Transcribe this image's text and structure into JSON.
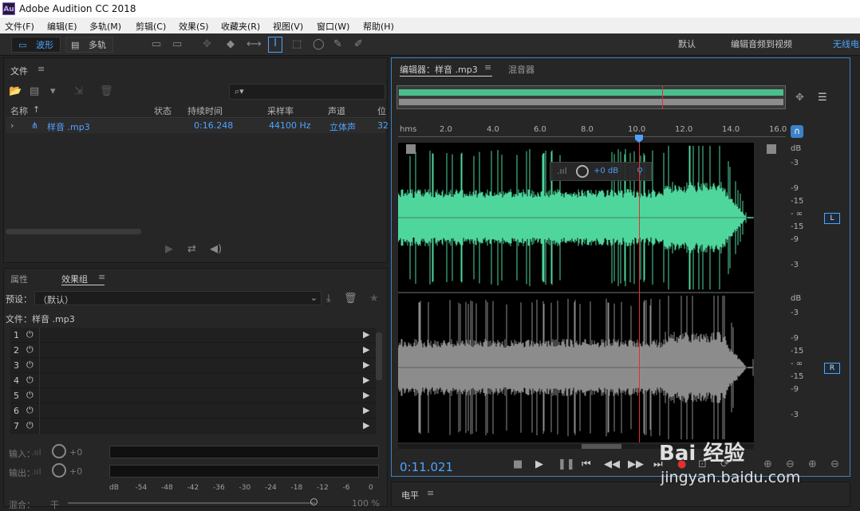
{
  "app": {
    "title": "Adobe Audition CC 2018",
    "icon_text": "Au"
  },
  "menubar": {
    "items": [
      "文件(F)",
      "编辑(E)",
      "多轨(M)",
      "剪辑(C)",
      "效果(S)",
      "收藏夹(R)",
      "视图(V)",
      "窗口(W)",
      "帮助(H)"
    ]
  },
  "toolbar": {
    "waveform_label": "波形",
    "multitrack_label": "多轨",
    "workspace_default": "默认",
    "workspace_edit_video": "编辑音频到视频",
    "workspace_wireless": "无线电"
  },
  "files_panel": {
    "title": "文件",
    "columns": [
      "名称",
      "状态",
      "持续时间",
      "采样率",
      "声道",
      "位"
    ],
    "rows": [
      {
        "name": "样音 .mp3",
        "status": "",
        "duration": "0:16.248",
        "sample_rate": "44100 Hz",
        "channels": "立体声",
        "bits": "32"
      }
    ]
  },
  "effects_panel": {
    "tab_properties": "属性",
    "tab_effects_rack": "效果组",
    "preset_label": "预设：",
    "preset_value": "（默认）",
    "file_label": "文件：样音 .mp3",
    "slots": [
      "1",
      "2",
      "3",
      "4",
      "5",
      "6",
      "7"
    ],
    "input_label": "输入：",
    "input_value": "+0",
    "output_label": "输出：",
    "output_value": "+0",
    "db_scale": [
      "dB",
      "-54",
      "-48",
      "-42",
      "-36",
      "-30",
      "-24",
      "-18",
      "-12",
      "-6",
      "0"
    ],
    "mix_label": "混合：",
    "mix_left": "干",
    "mix_value": "100 %"
  },
  "editor": {
    "tab_editor": "编辑器：样音 .mp3",
    "tab_mixer": "混音器",
    "time_unit": "hms",
    "ticks": [
      "2.0",
      "4.0",
      "6.0",
      "8.0",
      "10.0",
      "12.0",
      "14.0",
      "16.0"
    ],
    "hud_gain": "+0 dB",
    "db_labels_top": [
      "dB",
      "-3",
      "-9",
      "-15",
      "- ∞",
      "-15",
      "-9",
      "-3"
    ],
    "db_labels_bottom": [
      "dB",
      "-3",
      "-9",
      "-15",
      "- ∞",
      "-15",
      "-9",
      "-3"
    ],
    "channel_left": "L",
    "channel_right": "R",
    "current_time": "0:11.021",
    "playhead_fraction": 0.678,
    "wave_color_left": "#4fd69c",
    "wave_color_right": "#8c8c8c"
  },
  "level_panel": {
    "title": "电平"
  },
  "watermark": {
    "brand": "Bai 经验",
    "url": "jingyan.baidu.com"
  }
}
